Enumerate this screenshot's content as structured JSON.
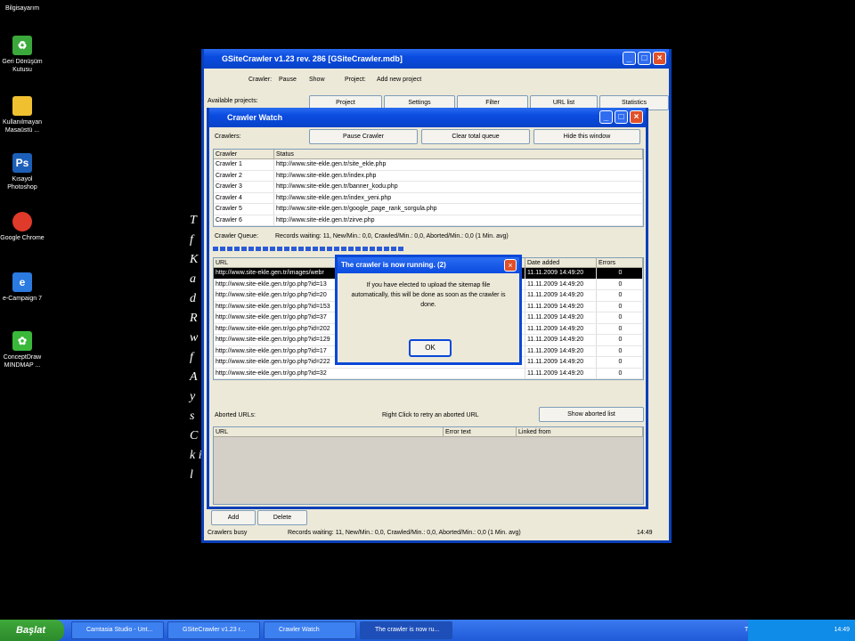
{
  "desktop": {
    "top_label": "Bilgisayarım",
    "icons": [
      {
        "label": "Geri Dönüşüm Kutusu",
        "icon": "recycle-bin-icon",
        "color": "#3aa83a"
      },
      {
        "label": "Kullanılmayan Masaüstü ...",
        "icon": "folder-icon",
        "color": "#f0c030"
      },
      {
        "label": "Kısayol Photoshop",
        "icon": "photoshop-icon",
        "color": "#1c5fb8"
      },
      {
        "label": "Google Chrome",
        "icon": "chrome-icon",
        "color": "#e03a2a"
      },
      {
        "label": "e-Campaign 7",
        "icon": "ecampaign-icon",
        "color": "#2a7ae0"
      },
      {
        "label": "ConceptDraw MINDMAP ...",
        "icon": "conceptdraw-icon",
        "color": "#3ab83a"
      }
    ]
  },
  "main_window": {
    "title": "GSiteCrawler v1.23 rev. 286 [GSiteCrawler.mdb]",
    "toolbar": {
      "crawler_label": "Crawler:",
      "pause_label": "Pause",
      "show_label": "Show",
      "project_label": "Project:",
      "add_project_label": "Add new project"
    },
    "available_projects": "Available projects:",
    "tabs": [
      "Project",
      "Settings",
      "Filter",
      "URL list",
      "Statistics"
    ],
    "side_text": "T f K a d R w f A y s C k il"
  },
  "crawler_watch": {
    "title": "Crawler Watch",
    "crawlers_label": "Crawlers:",
    "pause_button": "Pause Crawler",
    "clear_button": "Clear total queue",
    "hide_button": "Hide this window",
    "crawlers_headers": [
      "Crawler",
      "Status"
    ],
    "crawlers": [
      [
        "Crawler 1",
        "http://www.site-ekle.gen.tr/site_ekle.php"
      ],
      [
        "Crawler 2",
        "http://www.site-ekle.gen.tr/index.php"
      ],
      [
        "Crawler 3",
        "http://www.site-ekle.gen.tr/banner_kodu.php"
      ],
      [
        "Crawler 4",
        "http://www.site-ekle.gen.tr/index_yeni.php"
      ],
      [
        "Crawler 5",
        "http://www.site-ekle.gen.tr/google_page_rank_sorgula.php"
      ],
      [
        "Crawler 6",
        "http://www.site-ekle.gen.tr/zirve.php"
      ]
    ],
    "queue_label": "Crawler Queue:",
    "queue_stats": "Records waiting: 11, New/Min.: 0,0, Crawled/Min.: 0,0, Aborted/Min.: 0,0 (1 Min. avg)",
    "queue_headers": [
      "URL",
      "Date added",
      "Errors"
    ],
    "queue_rows": [
      [
        "http://www.site-ekle.gen.tr/images/webr",
        "11.11.2009 14:49:20",
        "0"
      ],
      [
        "http://www.site-ekle.gen.tr/go.php?id=13",
        "11.11.2009 14:49:20",
        "0"
      ],
      [
        "http://www.site-ekle.gen.tr/go.php?id=20",
        "11.11.2009 14:49:20",
        "0"
      ],
      [
        "http://www.site-ekle.gen.tr/go.php?id=153",
        "11.11.2009 14:49:20",
        "0"
      ],
      [
        "http://www.site-ekle.gen.tr/go.php?id=37",
        "11.11.2009 14:49:20",
        "0"
      ],
      [
        "http://www.site-ekle.gen.tr/go.php?id=202",
        "11.11.2009 14:49:20",
        "0"
      ],
      [
        "http://www.site-ekle.gen.tr/go.php?id=129",
        "11.11.2009 14:49:20",
        "0"
      ],
      [
        "http://www.site-ekle.gen.tr/go.php?id=17",
        "11.11.2009 14:49:20",
        "0"
      ],
      [
        "http://www.site-ekle.gen.tr/go.php?id=222",
        "11.11.2009 14:49:20",
        "0"
      ],
      [
        "http://www.site-ekle.gen.tr/go.php?id=32",
        "11.11.2009 14:49:20",
        "0"
      ]
    ],
    "aborted_label": "Aborted URLs:",
    "aborted_hint": "Right Click to retry an aborted URL",
    "show_aborted_button": "Show aborted list",
    "aborted_headers": [
      "URL",
      "Error text",
      "Linked from"
    ]
  },
  "bottom": {
    "add_label": "Add",
    "delete_label": "Delete",
    "status_left": "Crawlers busy",
    "status_middle": "Records waiting: 11, New/Min.: 0,0, Crawled/Min.: 0,0, Aborted/Min.: 0,0 (1 Min. avg)",
    "status_time": "14:49"
  },
  "dialog": {
    "title": "The crawler is now running. (2)",
    "message": "If you have elected to upload the sitemap file automatically, this will be done as soon as the crawler is done.",
    "ok_label": "OK"
  },
  "taskbar": {
    "start_label": "Başlat",
    "tasks": [
      "Camtasia Studio - Unt...",
      "GSiteCrawler v1.23 r...",
      "Crawler Watch",
      "The crawler is now ru..."
    ],
    "lang": "TR",
    "clock": "14:49"
  }
}
